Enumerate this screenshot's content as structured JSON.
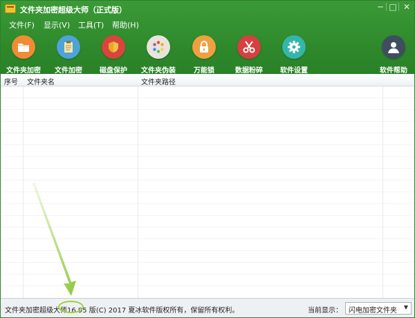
{
  "window": {
    "title": "文件夹加密超级大师（正式版）",
    "controls": {
      "minimize": "─",
      "maximize": "□",
      "close": "✕"
    }
  },
  "menu": [
    {
      "label": "文件(F)"
    },
    {
      "label": "显示(V)"
    },
    {
      "label": "工具(T)"
    },
    {
      "label": "帮助(H)"
    }
  ],
  "toolbar": {
    "folder_encrypt": {
      "label": "文件夹加密",
      "icon": "folder-icon",
      "color": "#f28b36"
    },
    "file_encrypt": {
      "label": "文件加密",
      "icon": "clipboard-icon",
      "color": "#4ea3d8"
    },
    "disk_protect": {
      "label": "磁盘保护",
      "icon": "shield-icon",
      "color": "#d9453c"
    },
    "folder_disguise": {
      "label": "文件夹伪装",
      "icon": "color-wheel-icon",
      "color": "#e8e4dc"
    },
    "universal_lock": {
      "label": "万能锁",
      "icon": "lock-icon",
      "color": "#f0a040"
    },
    "data_shred": {
      "label": "数据粉碎",
      "icon": "scissors-icon",
      "color": "#d64040"
    },
    "settings": {
      "label": "软件设置",
      "icon": "gear-icon",
      "color": "#34b6a8"
    },
    "help": {
      "label": "软件帮助",
      "icon": "user-icon",
      "color": "#3f4e5e"
    }
  },
  "list": {
    "columns": [
      {
        "label": "序号"
      },
      {
        "label": "文件夹名"
      },
      {
        "label": "文件夹路径"
      }
    ],
    "rows": []
  },
  "status": {
    "prefix": "文件夹加密超级大师",
    "version": "16.95 版",
    "suffix": "(C) 2017  夏冰软件版权所有，保留所有权利。",
    "current_label": "当前显示：",
    "current_value": "闪电加密文件夹"
  },
  "colors": {
    "header_green": "#2f8a2c",
    "annotation": "#9bd13a"
  }
}
